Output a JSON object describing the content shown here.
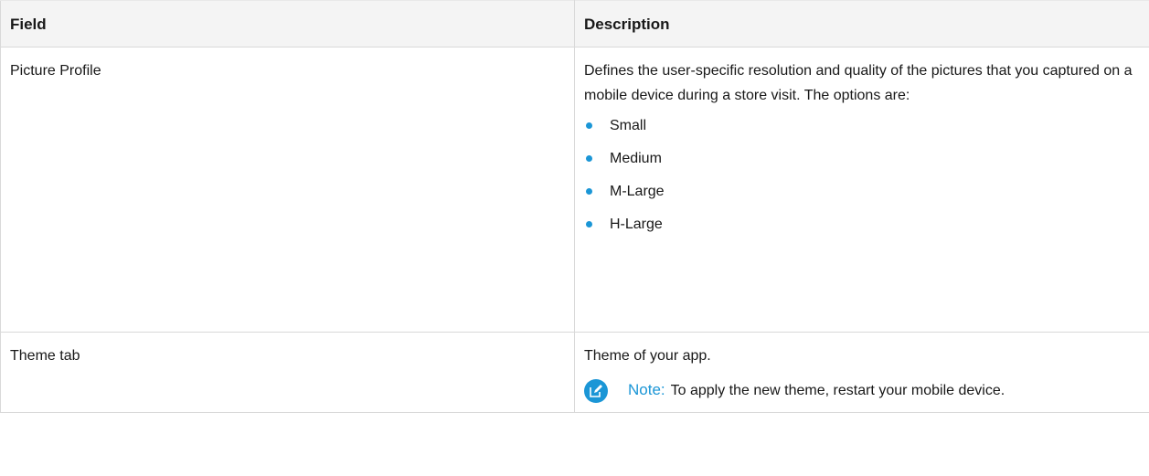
{
  "colors": {
    "accent": "#1b96d6",
    "header_bg": "#f4f4f4",
    "border": "#d9d9d9"
  },
  "table": {
    "headers": {
      "field": "Field",
      "description": "Description"
    },
    "rows": [
      {
        "field": "Picture Profile",
        "description": "Defines the user-specific resolution and quality of the pictures that you captured on a mobile device during a store visit. The options are:",
        "options": [
          "Small",
          "Medium",
          "M-Large",
          "H-Large"
        ]
      },
      {
        "field": "Theme tab",
        "description": "Theme of your app.",
        "note": {
          "icon": "edit-note-icon",
          "label": "Note:",
          "text": "To apply the new theme, restart your mobile device."
        }
      }
    ]
  }
}
